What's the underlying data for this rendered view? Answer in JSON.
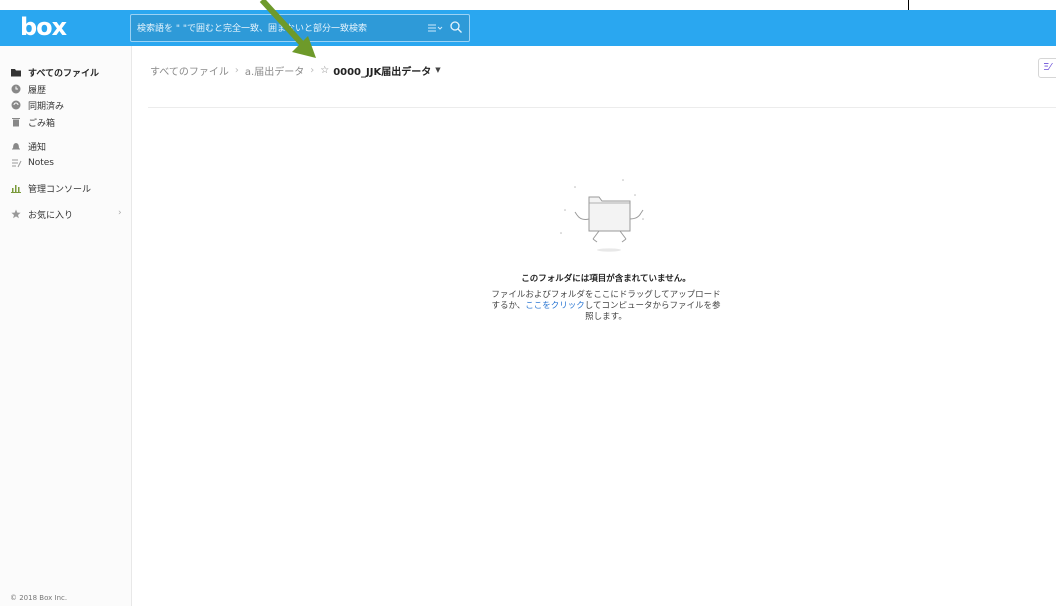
{
  "header": {
    "logo_text": "box",
    "search_placeholder": "検索語を \" \"で囲むと完全一致、囲まないと部分一致検索",
    "accent": "#2aa7f0"
  },
  "sidebar": {
    "items": [
      {
        "label": "すべてのファイル",
        "icon": "folder-icon"
      },
      {
        "label": "履歴",
        "icon": "clock-icon"
      },
      {
        "label": "同期済み",
        "icon": "sync-icon"
      },
      {
        "label": "ごみ箱",
        "icon": "trash-icon"
      },
      {
        "label": "通知",
        "icon": "bell-icon"
      },
      {
        "label": "Notes",
        "icon": "notes-icon"
      },
      {
        "label": "管理コンソール",
        "icon": "chart-icon"
      },
      {
        "label": "お気に入り",
        "icon": "star-icon"
      }
    ],
    "copyright": "© 2018 Box Inc."
  },
  "breadcrumb": {
    "root": "すべてのファイル",
    "parent": "a.届出データ",
    "current": "0000_JJK届出データ"
  },
  "toolbar": {
    "view_button_label": "Ξ⁄"
  },
  "empty_state": {
    "title": "このフォルダには項目が含まれていません。",
    "line1": "ファイルおよびフォルダをここにドラッグしてアップロード",
    "line2_pre": "するか、",
    "line2_link": "ここをクリック",
    "line2_post": "してコンピュータからファイルを参",
    "line3": "照します。"
  }
}
